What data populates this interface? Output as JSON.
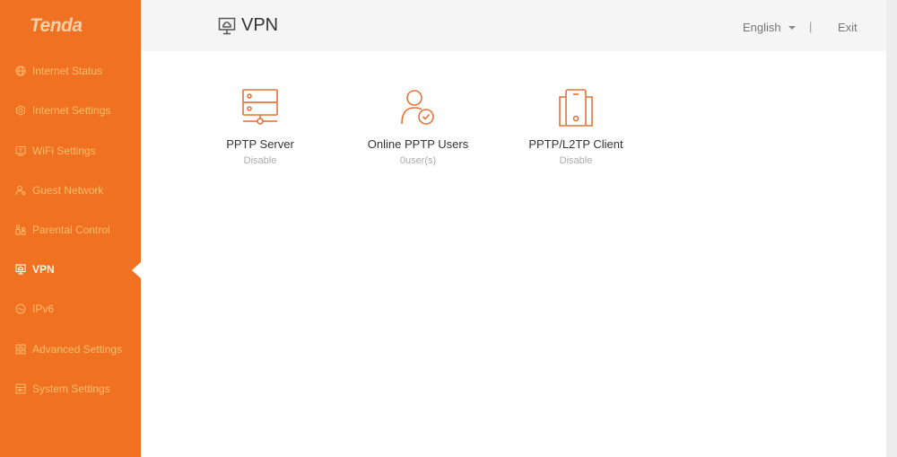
{
  "brand": {
    "logo_text": "Tenda",
    "accent": "#ef7121",
    "nav_text": "#fbbf6a"
  },
  "sidebar": {
    "items": [
      {
        "label": "Internet Status",
        "icon": "globe-icon"
      },
      {
        "label": "Internet Settings",
        "icon": "internet-settings-icon"
      },
      {
        "label": "WiFi Settings",
        "icon": "wifi-settings-icon"
      },
      {
        "label": "Guest Network",
        "icon": "guest-icon"
      },
      {
        "label": "Parental Control",
        "icon": "parental-icon"
      },
      {
        "label": "VPN",
        "icon": "vpn-icon",
        "active": true
      },
      {
        "label": "IPv6",
        "icon": "ipv6-icon"
      },
      {
        "label": "Advanced Settings",
        "icon": "grid-icon"
      },
      {
        "label": "System Settings",
        "icon": "system-icon"
      }
    ]
  },
  "header": {
    "title": "VPN",
    "language": "English",
    "separator": "|",
    "exit_label": "Exit"
  },
  "tiles": [
    {
      "label": "PPTP Server",
      "status": "Disable",
      "icon": "server-icon"
    },
    {
      "label": "Online PPTP Users",
      "status": "0user(s)",
      "icon": "user-check-icon"
    },
    {
      "label": "PPTP/L2TP Client",
      "status": "Disable",
      "icon": "phone-icon"
    }
  ]
}
